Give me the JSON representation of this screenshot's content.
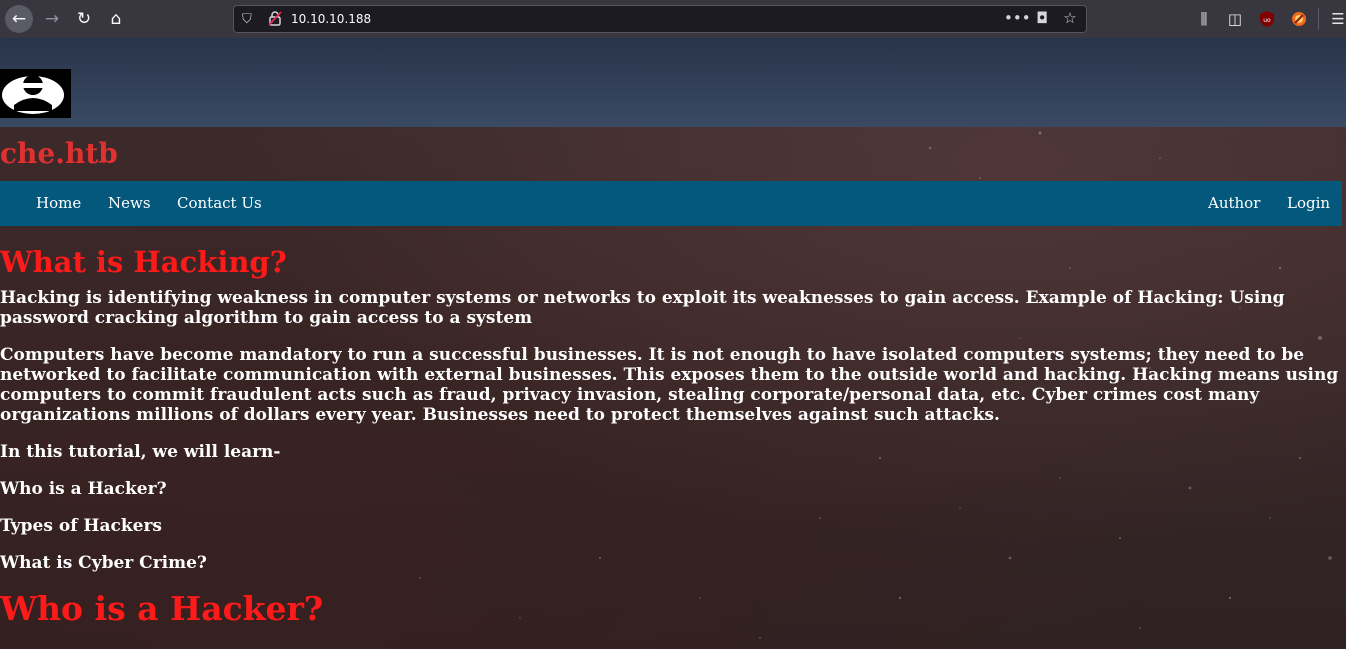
{
  "browser": {
    "url": "10.10.10.188",
    "back_icon": "arrow-left-icon",
    "forward_icon": "arrow-right-icon",
    "reload_icon": "reload-icon",
    "home_icon": "home-icon",
    "glyphs": {
      "back": "←",
      "forward": "→",
      "reload": "↻",
      "home": "⌂",
      "shield": "⛉",
      "more": "•••",
      "pocket": "◘",
      "bookmark": "☆",
      "library": "⫼",
      "sidebar": "◫",
      "ublock": "⬢",
      "ext": "●",
      "menu": "☰"
    }
  },
  "site": {
    "title": "che.htb",
    "nav_left": [
      "Home",
      "News",
      "Contact Us"
    ],
    "nav_right": [
      "Author",
      "Login"
    ]
  },
  "content": {
    "heading1": "What is Hacking?",
    "paragraphs": [
      "Hacking is identifying weakness in computer systems or networks to exploit its weaknesses to gain access. Example of Hacking: Using password cracking algorithm to gain access to a system",
      "Computers have become mandatory to run a successful businesses. It is not enough to have isolated computers systems; they need to be networked to facilitate communication with external businesses. This exposes them to the outside world and hacking. Hacking means using computers to commit fraudulent acts such as fraud, privacy invasion, stealing corporate/personal data, etc. Cyber crimes cost many organizations millions of dollars every year. Businesses need to protect themselves against such attacks.",
      "In this tutorial, we will learn-",
      "Who is a Hacker?",
      "Types of Hackers",
      "What is Cyber Crime?"
    ],
    "heading2": "Who is a Hacker?"
  },
  "colors": {
    "navbar": "#03587c",
    "heading": "#ff1a1a",
    "site_title": "#e03131",
    "chrome": "#38373f"
  }
}
